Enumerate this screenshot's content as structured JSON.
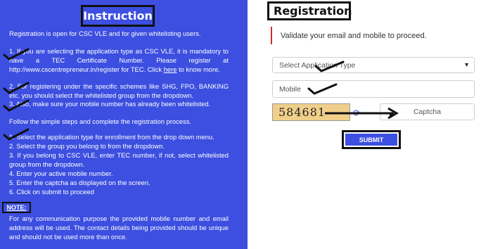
{
  "instructions": {
    "title": "Instruction",
    "intro": "Registration is open for CSC VLE and for given whitelisting users.",
    "p1_a": "1. If you are selecting the application type as CSC VLE, it is mandatory to have a TEC Certificate Number. Please register at http://www.cscentrepreneur.in/register for TEC. Click ",
    "p1_link": "here",
    "p1_b": " to know more.",
    "p2": "2. For registering under the specific schemes like SHG, FPO, BANKING etc. you should select the whitelisted group from the dropdown.",
    "p3": "3. Also, make sure your mobile number has already been whitelisted.",
    "follow": "Follow the simple steps and complete the registration process.",
    "steps": [
      "1. Select the application type for enrollment from the drop down menu.",
      "2. Select the group you belong to from the dropdown.",
      "3. If you belong to CSC VLE, enter TEC number, if not, select whitelisted group from the dropdown.",
      "4. Enter your active mobile number.",
      "5. Enter the captcha as displayed on the screen.",
      "6. Click on submit to proceed"
    ],
    "note_label": "NOTE:",
    "note_text": "For any communication purpose the provided mobile number and email address will be used. The contact details being provided should be unique and should not be used more than once."
  },
  "registration": {
    "title": "Registration",
    "alert": "Validate your email and mobile to proceed.",
    "application_type_placeholder": "Select Application Type",
    "mobile_placeholder": "Mobile",
    "captcha_text": "584681",
    "captcha_placeholder": "Captcha",
    "submit_label": "SUBMIT"
  },
  "colors": {
    "panel_blue": "#3c4fe0",
    "alert_red": "#d62b2b",
    "captcha_bg": "#f0cf8a"
  },
  "icons": {
    "refresh": "refresh-icon",
    "dropdown": "chevron-down-icon"
  }
}
